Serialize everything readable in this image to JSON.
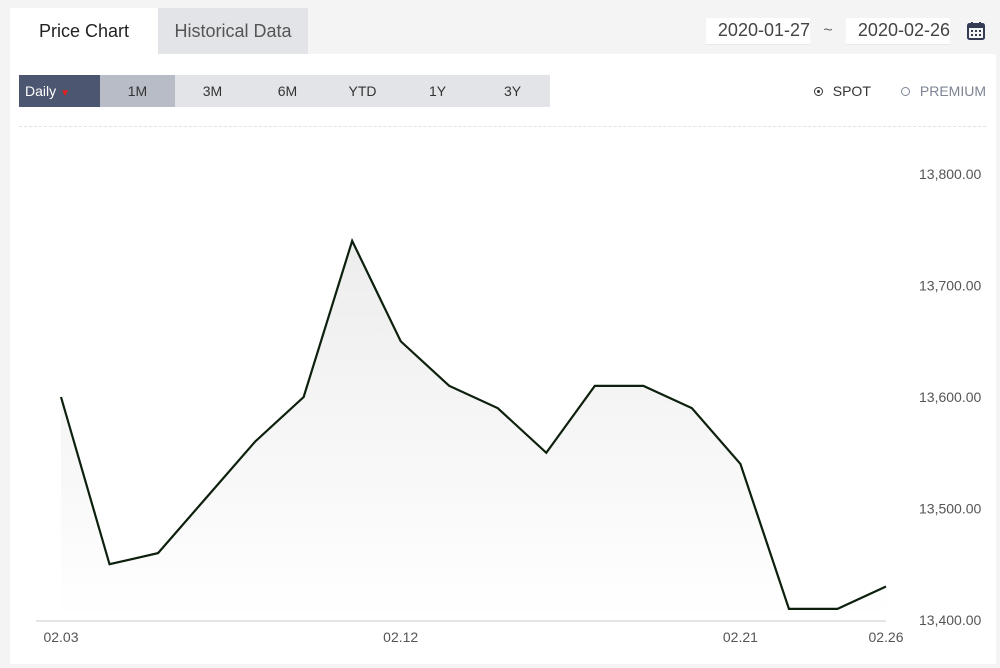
{
  "tabs": [
    {
      "label": "Price Chart",
      "active": true
    },
    {
      "label": "Historical Data",
      "active": false
    }
  ],
  "date_range": {
    "start": "2020-01-27",
    "separator": "~",
    "end": "2020-02-26"
  },
  "periods": {
    "daily_label": "Daily",
    "items": [
      "1M",
      "3M",
      "6M",
      "YTD",
      "1Y",
      "3Y"
    ],
    "selected": "1M"
  },
  "price_type": {
    "options": [
      "SPOT",
      "PREMIUM"
    ],
    "selected": "SPOT"
  },
  "colors": {
    "line": "#0d1f0d",
    "accent": "#4d5670",
    "caret": "#e02020"
  },
  "icons": {
    "calendar": "calendar-icon"
  },
  "chart_data": {
    "type": "area",
    "x": [
      "02.03",
      "02.04",
      "02.05",
      "02.06",
      "02.07",
      "02.10",
      "02.11",
      "02.12",
      "02.13",
      "02.14",
      "02.17",
      "02.18",
      "02.19",
      "02.20",
      "02.21",
      "02.24",
      "02.25",
      "02.26"
    ],
    "values": [
      13600,
      13450,
      13460,
      13510,
      13560,
      13600,
      13740,
      13650,
      13610,
      13590,
      13550,
      13610,
      13610,
      13590,
      13540,
      13410,
      13410,
      13430
    ],
    "x_tick_labels": [
      "02.03",
      "02.12",
      "02.21",
      "02.26"
    ],
    "y_ticks": [
      "13,800.00",
      "13,700.00",
      "13,600.00",
      "13,500.00",
      "13,400.00"
    ],
    "y_tick_values": [
      13800,
      13700,
      13600,
      13500,
      13400
    ],
    "ylim": [
      13400,
      13800
    ],
    "grid": false
  }
}
